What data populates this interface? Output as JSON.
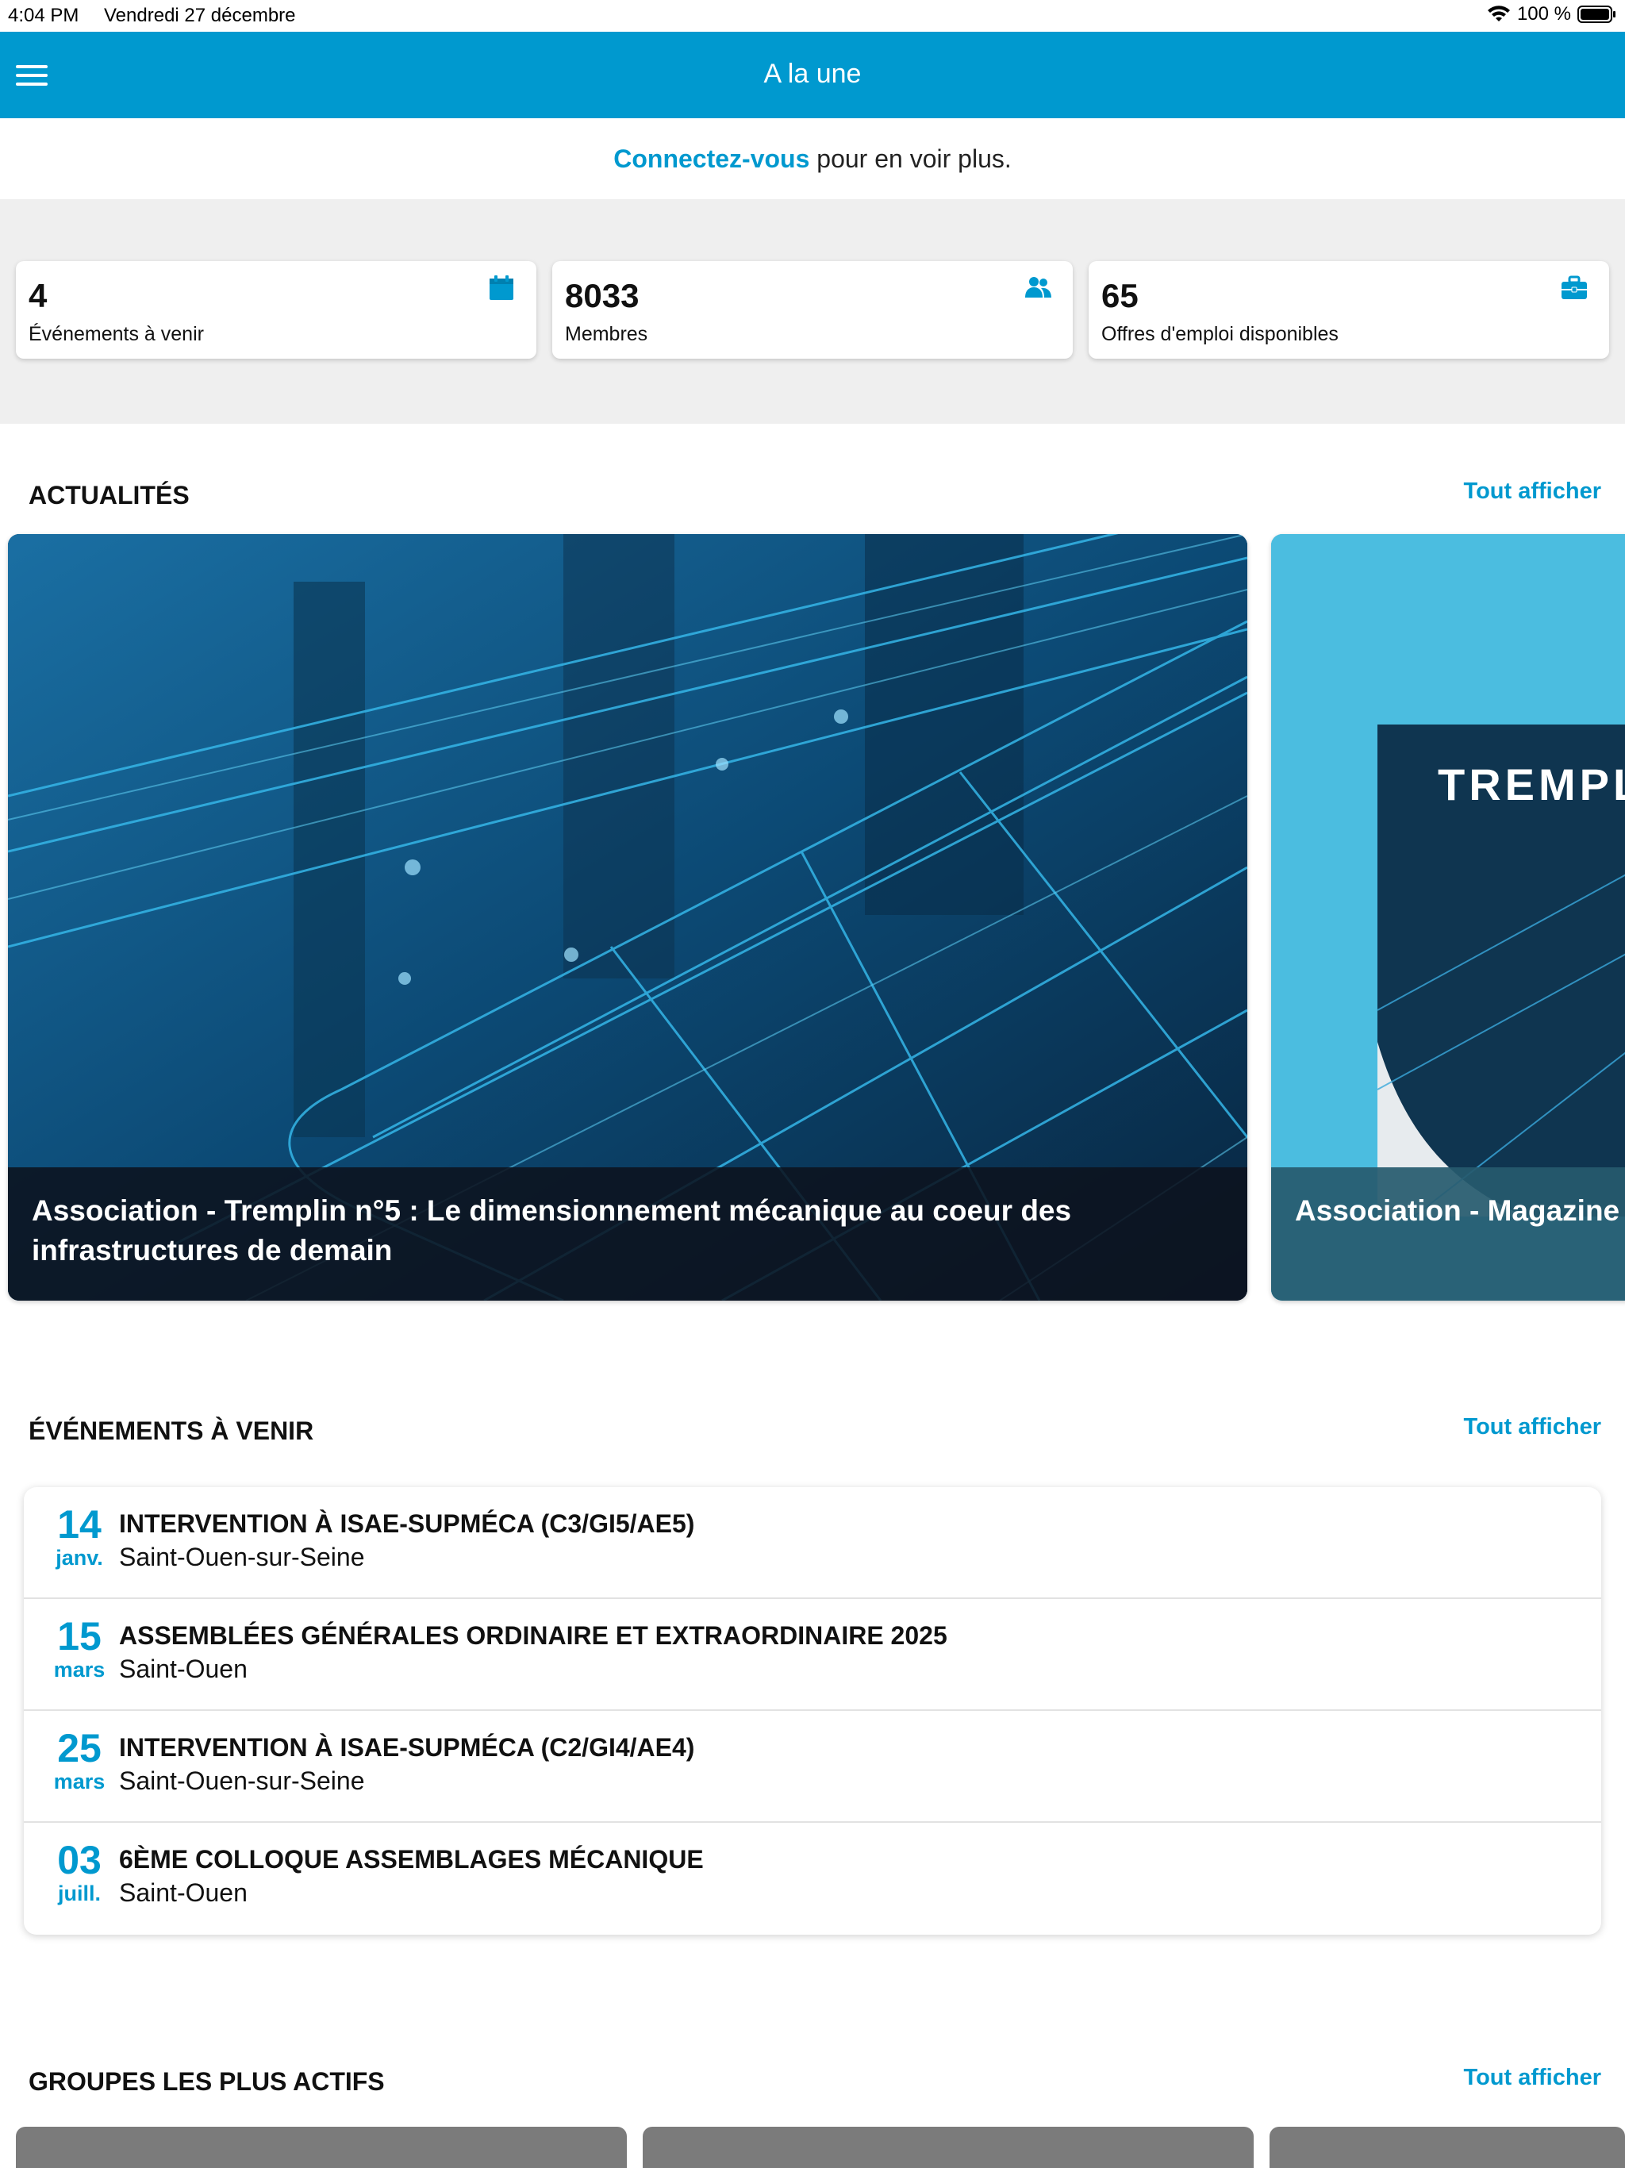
{
  "status_bar": {
    "time": "4:04 PM",
    "date": "Vendredi 27 décembre",
    "battery": "100 %"
  },
  "header": {
    "title": "A la une"
  },
  "login_prompt": {
    "link": "Connectez-vous",
    "text": " pour en voir plus."
  },
  "stats": [
    {
      "number": "4",
      "label": "Événements à venir",
      "icon": "calendar-icon"
    },
    {
      "number": "8033",
      "label": "Membres",
      "icon": "users-icon"
    },
    {
      "number": "65",
      "label": "Offres d'emploi disponibles",
      "icon": "briefcase-icon"
    }
  ],
  "news": {
    "title": "ACTUALITÉS",
    "see_all": "Tout afficher",
    "items": [
      {
        "title": "Association - Tremplin n°5 : Le dimensionnement mécanique au coeur des infrastructures de demain"
      },
      {
        "title": "Association - Magazine T",
        "cover_text": "TREMPL"
      }
    ]
  },
  "events": {
    "title": "ÉVÉNEMENTS À VENIR",
    "see_all": "Tout afficher",
    "items": [
      {
        "day": "14",
        "month": "janv.",
        "title": "INTERVENTION À ISAE-SUPMÉCA (C3/GI5/AE5)",
        "place": "Saint-Ouen-sur-Seine"
      },
      {
        "day": "15",
        "month": "mars",
        "title": "ASSEMBLÉES GÉNÉRALES ORDINAIRE ET EXTRAORDINAIRE 2025",
        "place": "Saint-Ouen"
      },
      {
        "day": "25",
        "month": "mars",
        "title": "INTERVENTION À ISAE-SUPMÉCA (C2/GI4/AE4)",
        "place": "Saint-Ouen-sur-Seine"
      },
      {
        "day": "03",
        "month": "juill.",
        "title": "6ÈME COLLOQUE ASSEMBLAGES MÉCANIQUE",
        "place": "Saint-Ouen"
      }
    ]
  },
  "groups": {
    "title": "GROUPES LES PLUS ACTIFS",
    "see_all": "Tout afficher"
  },
  "colors": {
    "accent": "#0099cf",
    "header_bg": "#0099cf",
    "stats_band_bg": "#efefef"
  }
}
